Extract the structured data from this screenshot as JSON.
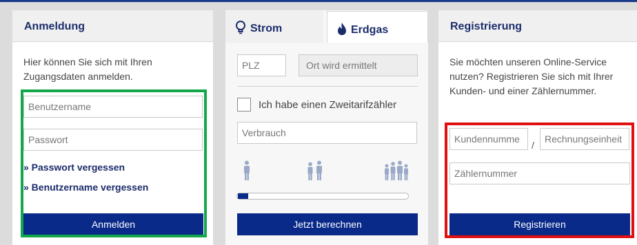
{
  "anmeldung": {
    "title": "Anmeldung",
    "intro": "Hier können Sie sich mit Ihren Zugangsdaten anmelden.",
    "username_placeholder": "Benutzername",
    "password_placeholder": "Passwort",
    "forgot_password": "» Passwort vergessen",
    "forgot_username": "» Benutzername vergessen",
    "login_button": "Anmelden"
  },
  "rechner": {
    "tab_strom": "Strom",
    "tab_erdgas": "Erdgas",
    "plz_placeholder": "PLZ",
    "ort_placeholder": "Ort wird ermittelt",
    "zweitarif_label": "Ich habe einen Zweitarifzähler",
    "verbrauch_placeholder": "Verbrauch",
    "calc_button": "Jetzt berechnen"
  },
  "registrierung": {
    "title": "Registrierung",
    "intro": "Sie möchten unseren Online-Service nutzen? Registrieren Sie sich mit Ihrer Kunden- und einer Zählernummer.",
    "kundennummer_placeholder": "Kundennumme",
    "separator": "/",
    "rechnungseinheit_placeholder": "Rechnungseinheit",
    "zaehlernummer_placeholder": "Zählernummer",
    "register_button": "Registrieren"
  },
  "colors": {
    "primary": "#0a2a8a",
    "heading": "#1b2c6b",
    "highlight_green": "#12a84a",
    "highlight_red": "#e01010"
  }
}
